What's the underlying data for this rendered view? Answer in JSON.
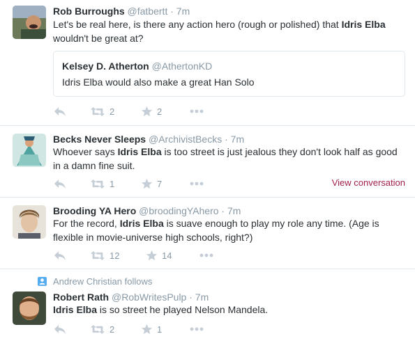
{
  "tweets": [
    {
      "name": "Rob Burroughs",
      "handle": "@fatbertt",
      "time": "7m",
      "text_pre": "Let's be real here, is there any action hero (rough or polished) that ",
      "text_bold": "Idris Elba",
      "text_post": " wouldn't be great at?",
      "quote": {
        "name": "Kelsey D. Atherton",
        "handle": "@AthertonKD",
        "text": "Idris Elba would also make a great Han Solo"
      },
      "retweets": "2",
      "favorites": "2"
    },
    {
      "name": "Becks Never Sleeps",
      "handle": "@ArchivistBecks",
      "time": "7m",
      "text_pre": "Whoever says ",
      "text_bold": "Idris Elba",
      "text_post": " is too street is just jealous they don't look half as good in a damn fine suit.",
      "retweets": "1",
      "favorites": "7",
      "view_conversation": "View conversation"
    },
    {
      "name": "Brooding YA Hero",
      "handle": "@broodingYAhero",
      "time": "7m",
      "text_pre": "For the record, ",
      "text_bold": "Idris Elba",
      "text_post": " is suave enough to play my role any time. (Age is flexible in movie-universe high schools, right?)",
      "retweets": "12",
      "favorites": "14"
    },
    {
      "context": "Andrew Christian follows",
      "name": "Robert Rath",
      "handle": "@RobWritesPulp",
      "time": "7m",
      "text_pre": "",
      "text_bold": "Idris Elba",
      "text_post": " is so street he played Nelson Mandela.",
      "retweets": "2",
      "favorites": "1"
    }
  ],
  "separator": "·",
  "icons": {
    "reply": "reply-icon",
    "retweet": "retweet-icon",
    "favorite": "star-icon",
    "more": "more-icon",
    "context": "person-icon"
  },
  "colors": {
    "link_accent": "#a0204c",
    "muted": "#8899a6",
    "border": "#e1e8ed"
  }
}
